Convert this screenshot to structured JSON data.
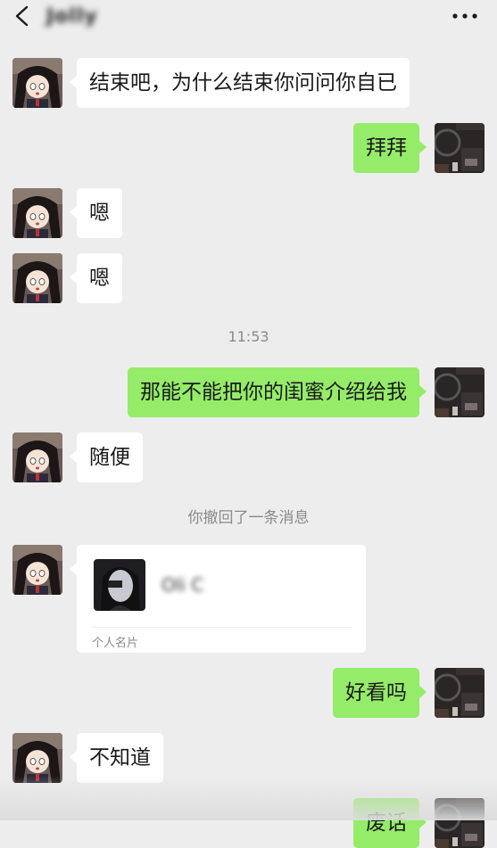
{
  "header": {
    "title": "Jolly"
  },
  "messages": {
    "m1": "结束吧，为什么结束你问问你自已",
    "m2": "拜拜",
    "m3": "嗯",
    "m4": "嗯",
    "time1": "11:53",
    "m5": "那能不能把你的闺蜜介绍给我",
    "m6": "随便",
    "recall": "你撤回了一条消息",
    "card_name": "Oli C",
    "card_label": "个人名片",
    "m7": "好看吗",
    "m8": "不知道",
    "m9": "废话"
  },
  "colors": {
    "sent_bubble": "#95ec69",
    "received_bubble": "#ffffff",
    "background": "#ededed"
  }
}
